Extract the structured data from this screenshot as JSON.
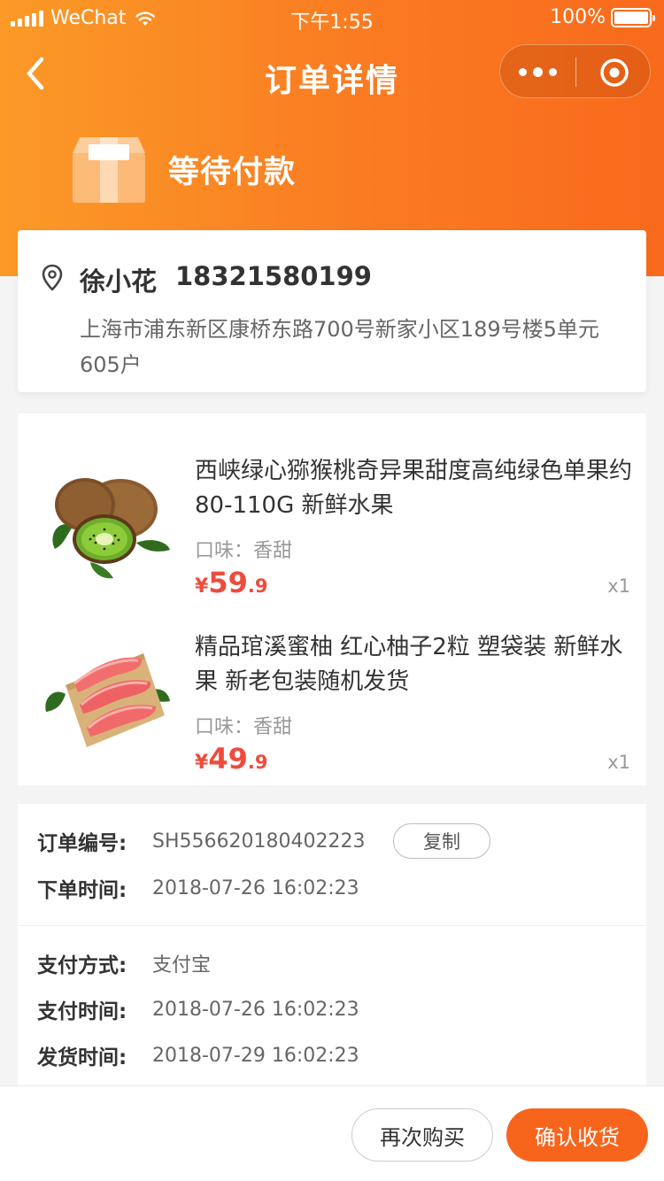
{
  "status_bar": {
    "carrier": "WeChat",
    "time": "下午1:55",
    "battery": "100%"
  },
  "nav": {
    "title": "订单详情"
  },
  "order_status": {
    "text": "等待付款"
  },
  "address": {
    "name": "徐小花",
    "phone": "18321580199",
    "detail": "上海市浦东新区康桥东路700号新家小区189号楼5单元605户"
  },
  "goods": [
    {
      "title": "西峡绿心猕猴桃奇异果甜度高纯绿色单果约80-110G 新鲜水果",
      "spec": "口味：香甜",
      "currency": "¥",
      "price_int": "59",
      "price_dec": ".9",
      "qty": "x1",
      "image_icon": "kiwi-fruit-image"
    },
    {
      "title": "精品琯溪蜜柚 红心柚子2粒 塑袋装 新鲜水果 新老包装随机发货",
      "spec": "口味：香甜",
      "currency": "¥",
      "price_int": "49",
      "price_dec": ".9",
      "qty": "x1",
      "image_icon": "pomelo-fruit-image"
    }
  ],
  "order_info": {
    "order_no_label": "订单编号:",
    "order_no": "SH556620180402223",
    "copy_label": "复制",
    "order_time_label": "下单时间:",
    "order_time": "2018-07-26 16:02:23",
    "pay_method_label": "支付方式:",
    "pay_method": "支付宝",
    "pay_time_label": "支付时间:",
    "pay_time": "2018-07-26 16:02:23",
    "ship_time_label": "发货时间:",
    "ship_time": "2018-07-29 16:02:23"
  },
  "actions": {
    "rebuy": "再次购买",
    "confirm": "确认收货"
  },
  "colors": {
    "accent": "#f96a1c",
    "price": "#ef4b3c",
    "header_start": "#fb9a27"
  }
}
